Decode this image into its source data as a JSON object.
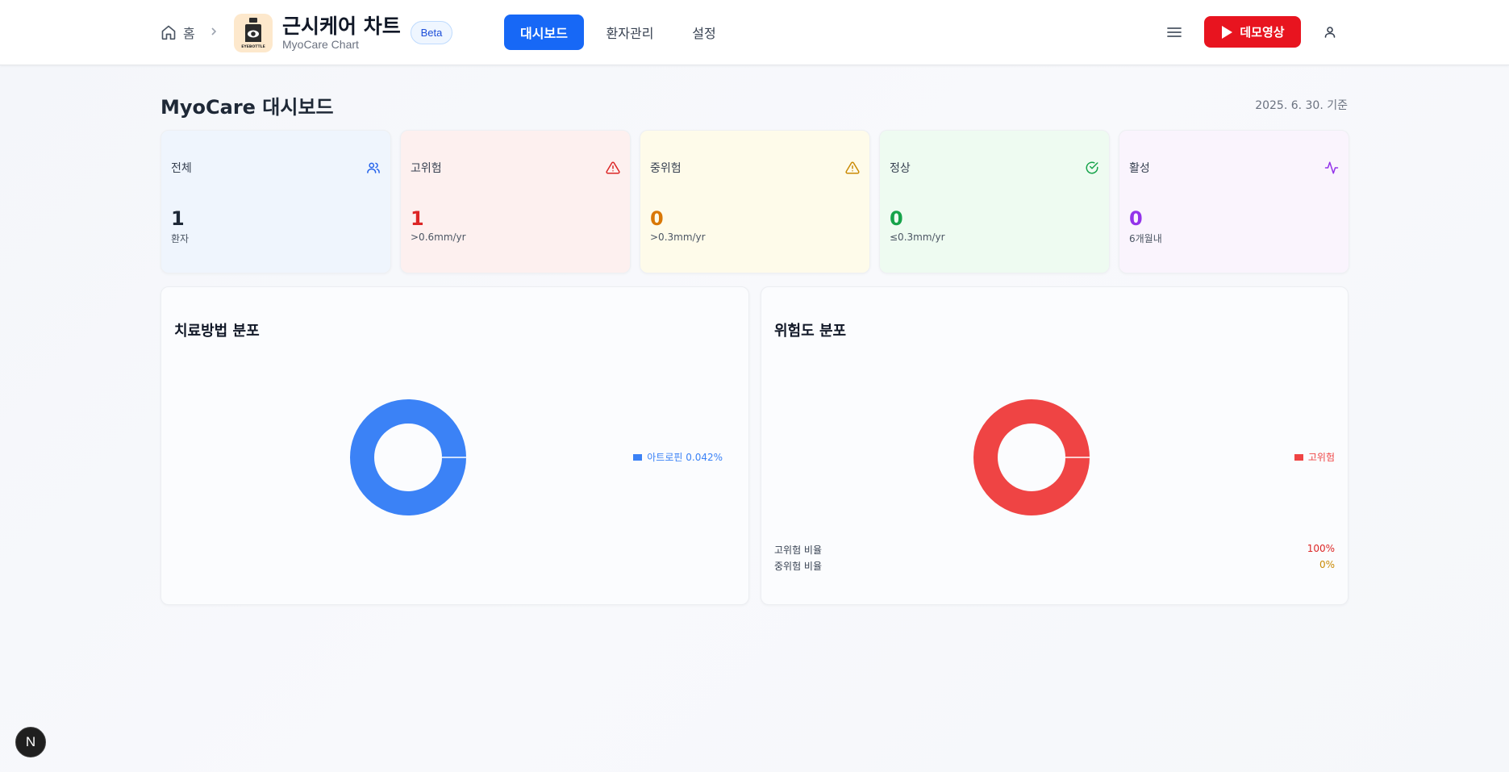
{
  "header": {
    "home_label": "홈",
    "app_title": "근시케어 차트",
    "app_subtitle": "MyoCare Chart",
    "beta_label": "Beta",
    "logo_text": "EYEBOTTLE",
    "nav": [
      {
        "label": "대시보드",
        "active": true
      },
      {
        "label": "환자관리",
        "active": false
      },
      {
        "label": "설정",
        "active": false
      }
    ],
    "demo_button_label": "데모영상"
  },
  "page": {
    "title": "MyoCare 대시보드",
    "date": "2025. 6. 30. 기준"
  },
  "stats": [
    {
      "label": "전체",
      "value": "1",
      "sub": "환자",
      "icon": "users-icon",
      "color": "#1f2937",
      "icon_color": "#2563eb",
      "bg": "#eff5fd"
    },
    {
      "label": "고위험",
      "value": "1",
      "sub": ">0.6mm/yr",
      "icon": "alert-triangle-icon",
      "color": "#dc2626",
      "icon_color": "#dc2626",
      "bg": "#fdf0ef"
    },
    {
      "label": "중위험",
      "value": "0",
      "sub": ">0.3mm/yr",
      "icon": "alert-triangle-icon",
      "color": "#d97706",
      "icon_color": "#ca8a04",
      "bg": "#fefbea"
    },
    {
      "label": "정상",
      "value": "0",
      "sub": "≤0.3mm/yr",
      "icon": "check-circle-icon",
      "color": "#16a34a",
      "icon_color": "#16a34a",
      "bg": "#eefbf1"
    },
    {
      "label": "활성",
      "value": "0",
      "sub": "6개월내",
      "icon": "activity-icon",
      "color": "#9333ea",
      "icon_color": "#9333ea",
      "bg": "#faf4fd"
    }
  ],
  "chart_data": [
    {
      "type": "pie",
      "title": "치료방법 분포",
      "categories": [
        "아트로핀 0.042%"
      ],
      "values": [
        1
      ],
      "colors": [
        "#3b82f6"
      ],
      "legend": "right"
    },
    {
      "type": "pie",
      "title": "위험도 분포",
      "categories": [
        "고위험"
      ],
      "values": [
        1
      ],
      "colors": [
        "#ef4444"
      ],
      "legend": "right"
    }
  ],
  "risk_ratios": [
    {
      "label": "고위험 비율",
      "value": "100%",
      "color": "#dc2626"
    },
    {
      "label": "중위험 비율",
      "value": "0%",
      "color": "#ca8a04"
    }
  ],
  "badge": {
    "label": "N"
  }
}
